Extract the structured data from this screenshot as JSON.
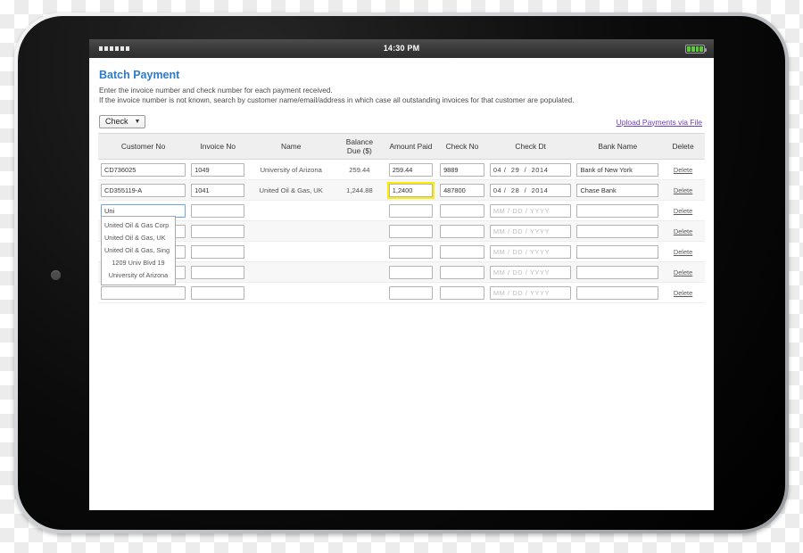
{
  "status_bar": {
    "time": "14:30 PM",
    "signal_icon": "signal-squares-icon",
    "battery_icon": "battery-full-icon"
  },
  "page": {
    "title": "Batch Payment",
    "description_line1": "Enter the invoice number and check number for each payment received.",
    "description_line2": "If the invoice number is not known, search by customer name/email/address in which case all outstanding invoices for that customer are populated."
  },
  "toolbar": {
    "payment_type_selected": "Check",
    "payment_type_caret": "▼",
    "upload_link": "Upload Payments via File"
  },
  "table": {
    "headers": [
      "Customer No",
      "Invoice No",
      "Name",
      "Balance Due ($)",
      "Amount Paid",
      "Check No",
      "Check Dt",
      "Bank Name",
      "Delete"
    ],
    "header_balance_line1": "Balance",
    "header_balance_line2": "Due ($)",
    "date_placeholder": "MM / DD / YYYY",
    "delete_label": "Delete",
    "rows": [
      {
        "customer_no": "CD736025",
        "invoice_no": "1049",
        "name": "University of Arizona",
        "balance_due": "259.44",
        "amount_paid": "259.44",
        "amount_highlighted": false,
        "check_no": "9889",
        "check_mm": "04",
        "check_dd": "29",
        "check_yyyy": "2014",
        "bank_name": "Bank of New York"
      },
      {
        "customer_no": "CD355119-A",
        "invoice_no": "1041",
        "name": "United Oil & Gas, UK",
        "balance_due": "1,244.88",
        "amount_paid": "1,2400",
        "amount_highlighted": true,
        "check_no": "487800",
        "check_mm": "04",
        "check_dd": "28",
        "check_yyyy": "2014",
        "bank_name": "Chase Bank"
      },
      {
        "customer_no": "Uni",
        "customer_focused": true,
        "invoice_no": "",
        "name": "",
        "balance_due": "",
        "amount_paid": "",
        "amount_highlighted": false,
        "check_no": "",
        "check_mm": "",
        "check_dd": "",
        "check_yyyy": "",
        "bank_name": ""
      },
      {
        "customer_no": "",
        "invoice_no": "",
        "name": "",
        "balance_due": "",
        "amount_paid": "",
        "amount_highlighted": false,
        "check_no": "",
        "check_mm": "",
        "check_dd": "",
        "check_yyyy": "",
        "bank_name": ""
      },
      {
        "customer_no": "",
        "invoice_no": "",
        "name": "",
        "balance_due": "",
        "amount_paid": "",
        "amount_highlighted": false,
        "check_no": "",
        "check_mm": "",
        "check_dd": "",
        "check_yyyy": "",
        "bank_name": ""
      },
      {
        "customer_no": "",
        "invoice_no": "",
        "name": "",
        "balance_due": "",
        "amount_paid": "",
        "amount_highlighted": false,
        "check_no": "",
        "check_mm": "",
        "check_dd": "",
        "check_yyyy": "",
        "bank_name": ""
      },
      {
        "customer_no": "",
        "invoice_no": "",
        "name": "",
        "balance_due": "",
        "amount_paid": "",
        "amount_highlighted": false,
        "check_no": "",
        "check_mm": "",
        "check_dd": "",
        "check_yyyy": "",
        "bank_name": ""
      }
    ]
  },
  "autocomplete": {
    "query": "Uni",
    "items": [
      {
        "label": "United Oil & Gas Corp",
        "center": false
      },
      {
        "label": "United Oil & Gas, UK",
        "center": false
      },
      {
        "label": "United Oil & Gas, Sing",
        "center": false
      },
      {
        "label": "1209 Univ Blvd 19",
        "center": true
      },
      {
        "label": "University of Arizona",
        "center": true
      }
    ]
  },
  "colors": {
    "title_blue": "#2b7bd0",
    "link_purple": "#6a3fbd",
    "highlight_yellow": "#ffec00",
    "battery_green": "#5ec83c"
  }
}
